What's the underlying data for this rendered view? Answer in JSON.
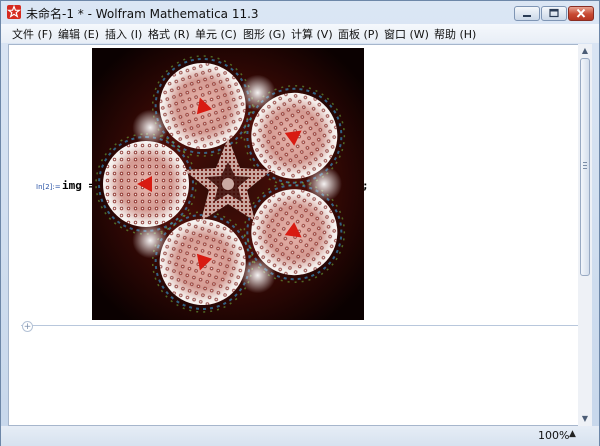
{
  "window": {
    "title": "未命名-1 * - Wolfram Mathematica 11.3"
  },
  "menu": {
    "items": [
      {
        "label": "文件 (F)"
      },
      {
        "label": "编辑 (E)"
      },
      {
        "label": "插入 (I)"
      },
      {
        "label": "格式 (R)"
      },
      {
        "label": "单元 (C)"
      },
      {
        "label": "图形 (G)"
      },
      {
        "label": "计算 (V)"
      },
      {
        "label": "面板 (P)"
      },
      {
        "label": "窗口 (W)"
      },
      {
        "label": "帮助 (H)"
      }
    ]
  },
  "notebook": {
    "input_label": "In[2]:=",
    "code_prefix": "img =",
    "code_suffix": ";"
  },
  "status": {
    "zoom": "100%"
  },
  "icons": {
    "app": "mathematica-logo-icon",
    "minimize": "minimize-icon",
    "maximize": "maximize-icon",
    "close": "close-icon"
  },
  "colors": {
    "accent": "#d62a1f",
    "label": "#2d56a8"
  }
}
